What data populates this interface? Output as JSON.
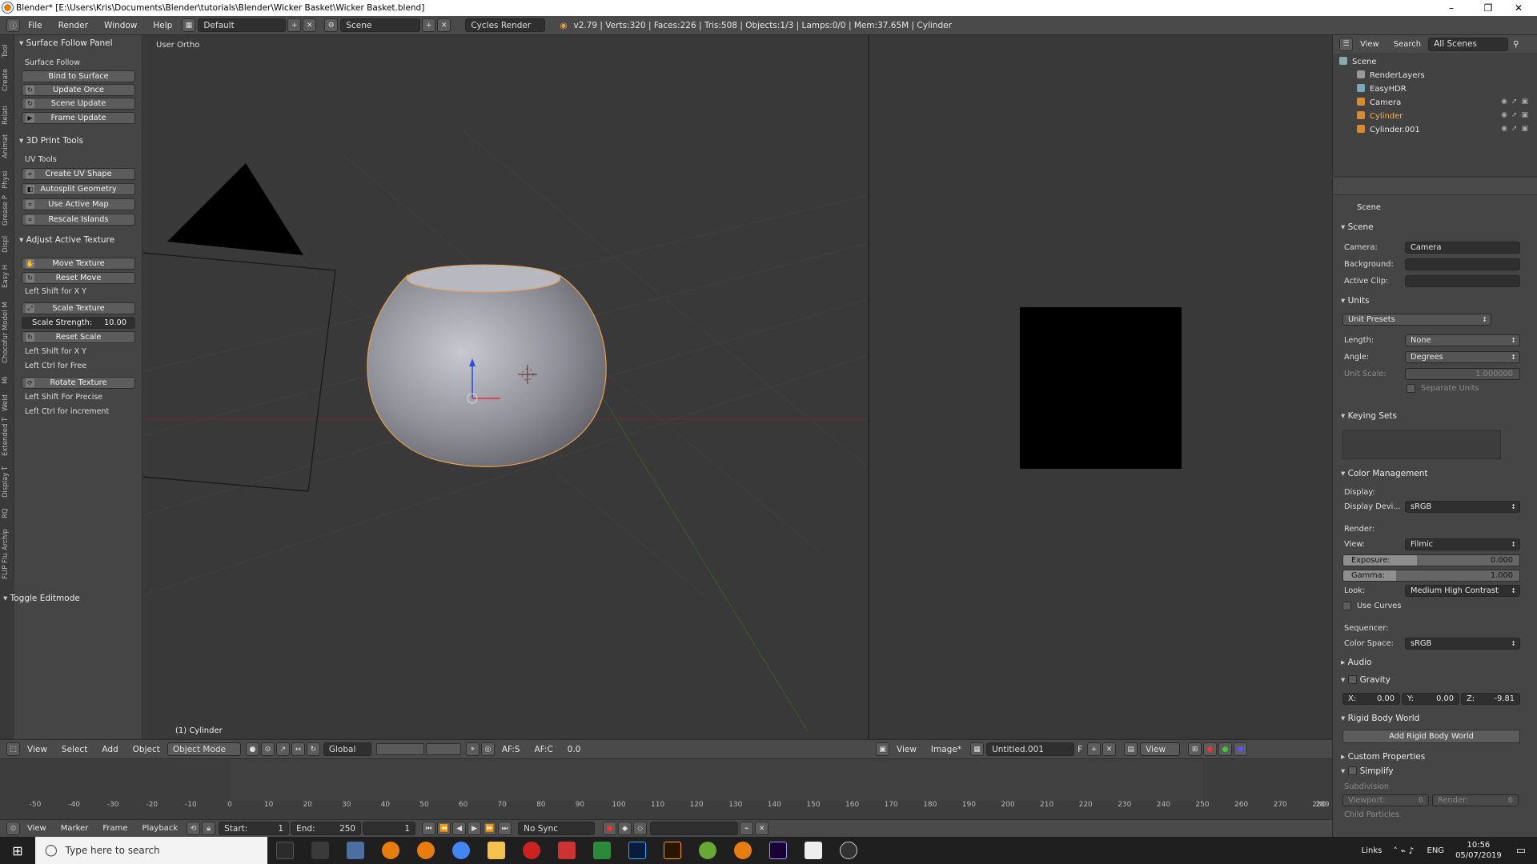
{
  "window": {
    "title": "Blender* [E:\\Users\\Kris\\Documents\\Blender\\tutorials\\Blender\\Wicker Basket\\Wicker Basket.blend]",
    "minimize": "–",
    "maximize": "❐",
    "close": "✕"
  },
  "topbar": {
    "menus": [
      "File",
      "Render",
      "Window",
      "Help"
    ],
    "layout": "Default",
    "scene": "Scene",
    "engine": "Cycles Render",
    "stats": "v2.79 | Verts:320 | Faces:226 | Tris:508 | Objects:1/3 | Lamps:0/0 | Mem:37.65M | Cylinder"
  },
  "tabs": [
    "Tool",
    "Create",
    "Relati",
    "Animat",
    "Physi",
    "Grease P",
    "Displ",
    "Easy H",
    "Chocofur Model M",
    "Mi",
    "Weld",
    "Extended T",
    "Display T",
    "RQ",
    "Archip",
    "FLIP Flu"
  ],
  "toolshelf": {
    "surface_follow": {
      "title": "Surface Follow Panel",
      "label": "Surface Follow",
      "bind": "Bind to Surface",
      "update_once": "Update Once",
      "scene_update": "Scene Update",
      "frame_update": "Frame Update"
    },
    "print3d": {
      "title": "3D Print Tools",
      "label": "UV Tools",
      "create_uv": "Create UV Shape",
      "autosplit": "Autosplit Geometry",
      "use_active": "Use Active Map",
      "rescale": "Rescale Islands"
    },
    "adjust": {
      "title": "Adjust Active Texture",
      "move": "Move Texture",
      "reset_move": "Reset Move",
      "hint1": "Left Shift for X Y",
      "scale": "Scale Texture",
      "strength_label": "Scale Strength:",
      "strength_value": "10.00",
      "reset_scale": "Reset Scale",
      "hint2": "Left Shift for X Y",
      "hint3": "Left Ctrl for Free",
      "rotate": "Rotate Texture",
      "hint4": "Left Shift For Precise",
      "hint5": "Left Ctrl for increment"
    },
    "toggle_editmode": "Toggle Editmode"
  },
  "viewport": {
    "label": "User Ortho",
    "object": "(1) Cylinder"
  },
  "vpheader": {
    "menus": [
      "View",
      "Select",
      "Add",
      "Object"
    ],
    "mode": "Object Mode",
    "orientation": "Global",
    "afs": "AF:S",
    "afc": "AF:C",
    "value": "0.0"
  },
  "ieheader": {
    "menus": [
      "View",
      "Image*"
    ],
    "image": "Untitled.001",
    "f": "F",
    "view": "View"
  },
  "timeline": {
    "ticks": [
      "-50",
      "-40",
      "-30",
      "-20",
      "-10",
      "0",
      "10",
      "20",
      "30",
      "40",
      "50",
      "60",
      "70",
      "80",
      "90",
      "100",
      "110",
      "120",
      "130",
      "140",
      "150",
      "160",
      "170",
      "180",
      "190",
      "200",
      "210",
      "220",
      "230",
      "240",
      "250",
      "260",
      "270",
      "280"
    ],
    "end_tick": "289",
    "menus": [
      "View",
      "Marker",
      "Frame",
      "Playback"
    ],
    "start_label": "Start:",
    "start": "1",
    "end_label": "End:",
    "end": "250",
    "current": "1",
    "sync": "No Sync"
  },
  "outliner": {
    "menus": [
      "View",
      "Search"
    ],
    "filter": "All Scenes",
    "items": [
      "Scene",
      "RenderLayers",
      "EasyHDR",
      "Camera",
      "Cylinder",
      "Cylinder.001"
    ]
  },
  "props": {
    "context": "Scene",
    "scene": {
      "title": "Scene",
      "camera_label": "Camera:",
      "camera": "Camera",
      "bg_label": "Background:",
      "clip_label": "Active Clip:"
    },
    "units": {
      "title": "Units",
      "presets": "Unit Presets",
      "length_label": "Length:",
      "length": "None",
      "angle_label": "Angle:",
      "angle": "Degrees",
      "scale_label": "Unit Scale:",
      "scale": "1.000000",
      "separate": "Separate Units"
    },
    "keying": {
      "title": "Keying Sets"
    },
    "color": {
      "title": "Color Management",
      "display_label": "Display:",
      "device_label": "Display Devi...",
      "device": "sRGB",
      "render_label": "Render:",
      "view_label": "View:",
      "view": "Filmic",
      "exposure_label": "Exposure:",
      "exposure": "0.000",
      "gamma_label": "Gamma:",
      "gamma": "1.000",
      "look_label": "Look:",
      "look": "Medium High Contrast",
      "curves": "Use Curves",
      "seq_label": "Sequencer:",
      "cs_label": "Color Space:",
      "cs": "sRGB"
    },
    "audio": "Audio",
    "gravity": {
      "title": "Gravity",
      "x": "X:",
      "xv": "0.00",
      "y": "Y:",
      "yv": "0.00",
      "z": "Z:",
      "zv": "-9.81"
    },
    "rigid": {
      "title": "Rigid Body World",
      "button": "Add Rigid Body World"
    },
    "custom": "Custom Properties",
    "simplify": {
      "title": "Simplify",
      "sub": "Subdivision",
      "vp_label": "Viewport:",
      "vp": "6",
      "r_label": "Render:",
      "r": "6",
      "child": "Child Particles"
    }
  },
  "taskbar": {
    "search": "Type here to search",
    "links": "Links",
    "lang": "ENG",
    "time": "10:56",
    "date": "05/07/2019"
  }
}
